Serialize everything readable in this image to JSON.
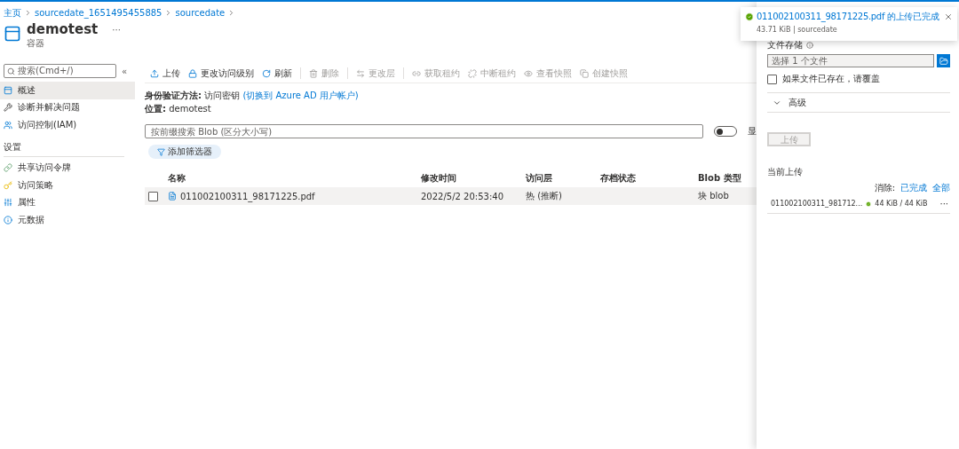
{
  "breadcrumb": [
    {
      "label": "主页"
    },
    {
      "label": "sourcedate_1651495455885"
    },
    {
      "label": "sourcedate"
    }
  ],
  "header": {
    "title": "demotest",
    "more": "···",
    "subtitle": "容器"
  },
  "sidebar": {
    "search": {
      "placeholder": "搜索(Cmd+/)"
    },
    "collapse": "«",
    "items": [
      {
        "kind": "item",
        "label": "概述",
        "selected": true
      },
      {
        "kind": "item",
        "label": "诊断并解决问题",
        "selected": false
      },
      {
        "kind": "item",
        "label": "访问控制(IAM)",
        "selected": false
      },
      {
        "kind": "heading",
        "label": "设置"
      },
      {
        "kind": "item",
        "label": "共享访问令牌",
        "selected": false
      },
      {
        "kind": "item",
        "label": "访问策略",
        "selected": false
      },
      {
        "kind": "item",
        "label": "属性",
        "selected": false
      },
      {
        "kind": "item",
        "label": "元数据",
        "selected": false
      }
    ]
  },
  "toolbar": [
    {
      "kind": "button",
      "label": "上传",
      "disabled": false
    },
    {
      "kind": "button",
      "label": "更改访问级别",
      "disabled": false
    },
    {
      "kind": "button",
      "label": "刷新",
      "disabled": false
    },
    {
      "kind": "separator"
    },
    {
      "kind": "button",
      "label": "删除",
      "disabled": true
    },
    {
      "kind": "separator"
    },
    {
      "kind": "button",
      "label": "更改层",
      "disabled": true
    },
    {
      "kind": "separator"
    },
    {
      "kind": "button",
      "label": "获取租约",
      "disabled": true
    },
    {
      "kind": "button",
      "label": "中断租约",
      "disabled": true
    },
    {
      "kind": "button",
      "label": "查看快照",
      "disabled": true
    },
    {
      "kind": "button",
      "label": "创建快照",
      "disabled": true
    }
  ],
  "auth": {
    "label": "身份验证方法:",
    "value": "访问密钥",
    "link": "(切换到 Azure AD 用户帐户)"
  },
  "location": {
    "label": "位置:",
    "value": "demotest"
  },
  "filter": {
    "placeholder": "按前缀搜索 Blob (区分大小写)",
    "toggle_on": false,
    "toggle_label": "显"
  },
  "add_filter": "添加筛选器",
  "table": {
    "columns": [
      "名称",
      "修改时间",
      "访问层",
      "存档状态",
      "Blob 类型"
    ],
    "rows": [
      {
        "selected": false,
        "hovered": true,
        "cells": [
          "011002100311_98171225.pdf",
          "2022/5/2 20:53:40",
          "热 (推断)",
          "",
          "块 blob"
        ]
      }
    ]
  },
  "panel": {
    "file_label": "文件存储",
    "file_placeholder": "选择 1 个文件",
    "overwrite": {
      "label": "如果文件已存在，请覆盖",
      "checked": false
    },
    "advanced": {
      "label": "高级",
      "expanded": false
    },
    "upload_button": {
      "label": "上传",
      "disabled": true
    },
    "current_uploads": "当前上传",
    "clear_label": "消除:",
    "clear_links": [
      "已完成",
      "全部"
    ],
    "uploads": [
      {
        "name": "011002100311_981712...",
        "done": true,
        "progress": "44 KiB / 44 KiB",
        "more": "···"
      }
    ]
  },
  "toast": {
    "title": "011002100311_98171225.pdf 的上传已完成",
    "detail": "43.71 KiB | sourcedate",
    "done": true
  }
}
